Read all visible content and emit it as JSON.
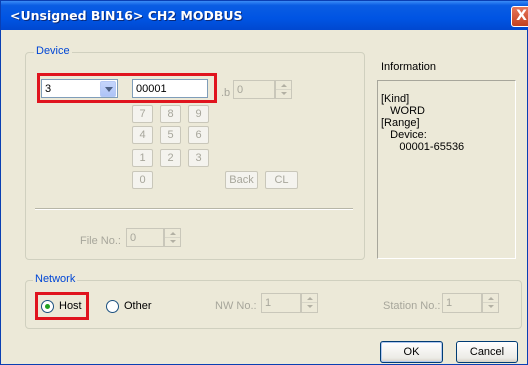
{
  "window": {
    "title": "<Unsigned BIN16> CH2 MODBUS",
    "close_symbol": "X"
  },
  "device": {
    "group_label": "Device",
    "combo_value": "3",
    "address_value": "00001",
    "bit_prefix": ".b",
    "bit_value": "0",
    "keypad": [
      "7",
      "8",
      "9",
      "4",
      "5",
      "6",
      "1",
      "2",
      "3",
      "0"
    ],
    "back_label": "Back",
    "clear_label": "CL",
    "file_no_label": "File No.:",
    "file_no_value": "0"
  },
  "information": {
    "label": "Information",
    "text": "[Kind]\n   WORD\n[Range]\n   Device:\n      00001-65536"
  },
  "network": {
    "group_label": "Network",
    "host_label": "Host",
    "other_label": "Other",
    "selected": "Host",
    "nw_no_label": "NW No.:",
    "nw_no_value": "1",
    "station_no_label": "Station No.:",
    "station_no_value": "1"
  },
  "buttons": {
    "ok": "OK",
    "cancel": "Cancel"
  }
}
